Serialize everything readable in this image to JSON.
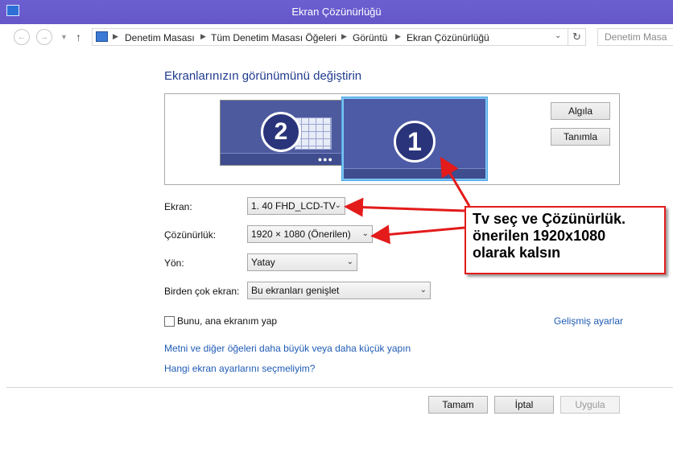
{
  "window": {
    "title": "Ekran Çözünürlüğü"
  },
  "nav": {
    "back_icon": "back-arrow-icon",
    "forward_icon": "forward-arrow-icon",
    "up_icon": "up-arrow-icon",
    "breadcrumbs": [
      "Denetim Masası",
      "Tüm Denetim Masası Öğeleri",
      "Görüntü",
      "Ekran Çözünürlüğü"
    ],
    "search_placeholder": "Denetim Masa"
  },
  "main": {
    "heading": "Ekranlarınızın görünümünü değiştirin",
    "monitors": [
      {
        "number": "2",
        "selected": false
      },
      {
        "number": "1",
        "selected": true
      }
    ],
    "buttons": {
      "detect": "Algıla",
      "identify": "Tanımla"
    },
    "fields": [
      {
        "label": "Ekran:",
        "value": "1. 40 FHD_LCD-TV"
      },
      {
        "label": "Çözünürlük:",
        "value": "1920 × 1080 (Önerilen)"
      },
      {
        "label": "Yön:",
        "value": "Yatay"
      },
      {
        "label": "Birden çok ekran:",
        "value": "Bu ekranları genişlet"
      }
    ],
    "primary_checkbox": {
      "label": "Bunu, ana ekranım yap",
      "checked": false
    },
    "advanced_link": "Gelişmiş ayarlar",
    "links": [
      "Metni ve diğer öğeleri daha büyük veya daha küçük yapın",
      "Hangi ekran ayarlarını seçmeliyim?"
    ],
    "dialog_buttons": {
      "ok": "Tamam",
      "cancel": "İptal",
      "apply": "Uygula"
    }
  },
  "annotation": {
    "lines": [
      "Tv seç ve Çözünürlük.",
      "önerilen 1920x1080",
      "olarak kalsın"
    ],
    "color": "#e31b1b"
  },
  "colors": {
    "titlebar": "#6a5acd",
    "link": "#1f5bb5",
    "monitor": "#4d5ba6",
    "heading": "#1f3b8e"
  }
}
